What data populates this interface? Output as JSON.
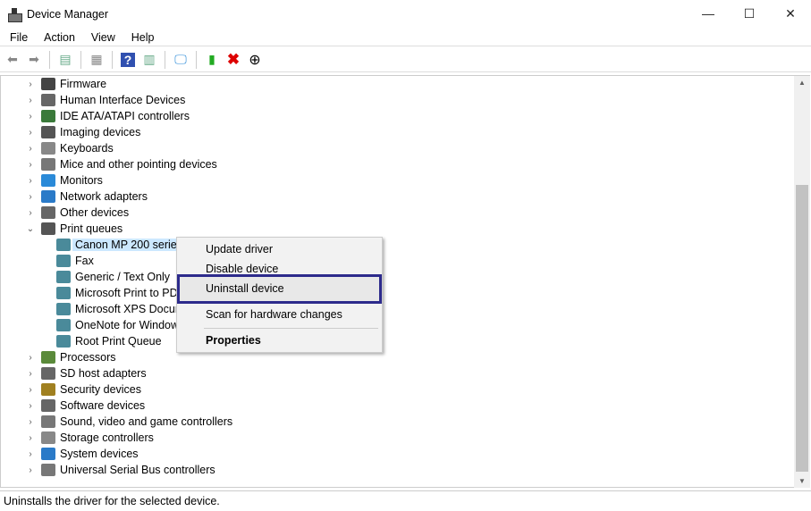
{
  "window": {
    "title": "Device Manager",
    "minimize": "—",
    "maximize": "☐",
    "close": "✕"
  },
  "menu": [
    "File",
    "Action",
    "View",
    "Help"
  ],
  "toolbar": [
    "back-icon",
    "forward-icon",
    "show-hide-console-tree-icon",
    "properties-icon",
    "help-icon",
    "action-pane-icon",
    "scan-hardware-icon",
    "update-driver-icon",
    "uninstall-icon",
    "disable-icon"
  ],
  "tree": [
    {
      "label": "Firmware",
      "level": 0,
      "expanded": false,
      "color": "#444"
    },
    {
      "label": "Human Interface Devices",
      "level": 0,
      "expanded": false,
      "color": "#666"
    },
    {
      "label": "IDE ATA/ATAPI controllers",
      "level": 0,
      "expanded": false,
      "color": "#3a7a3a"
    },
    {
      "label": "Imaging devices",
      "level": 0,
      "expanded": false,
      "color": "#555"
    },
    {
      "label": "Keyboards",
      "level": 0,
      "expanded": false,
      "color": "#888"
    },
    {
      "label": "Mice and other pointing devices",
      "level": 0,
      "expanded": false,
      "color": "#777"
    },
    {
      "label": "Monitors",
      "level": 0,
      "expanded": false,
      "color": "#2a8ad8"
    },
    {
      "label": "Network adapters",
      "level": 0,
      "expanded": false,
      "color": "#2a7ac8"
    },
    {
      "label": "Other devices",
      "level": 0,
      "expanded": false,
      "color": "#666"
    },
    {
      "label": "Print queues",
      "level": 0,
      "expanded": true,
      "color": "#555"
    },
    {
      "label": "Canon MP 200 series",
      "level": 1,
      "selected": true,
      "color": "#4a8a9a"
    },
    {
      "label": "Fax",
      "level": 1,
      "color": "#4a8a9a"
    },
    {
      "label": "Generic / Text Only",
      "level": 1,
      "color": "#4a8a9a"
    },
    {
      "label": "Microsoft Print to PDF",
      "level": 1,
      "color": "#4a8a9a"
    },
    {
      "label": "Microsoft XPS Document Writer",
      "level": 1,
      "color": "#4a8a9a"
    },
    {
      "label": "OneNote for Windows 10",
      "level": 1,
      "color": "#4a8a9a"
    },
    {
      "label": "Root Print Queue",
      "level": 1,
      "color": "#4a8a9a"
    },
    {
      "label": "Processors",
      "level": 0,
      "expanded": false,
      "color": "#5a8a3a"
    },
    {
      "label": "SD host adapters",
      "level": 0,
      "expanded": false,
      "color": "#666"
    },
    {
      "label": "Security devices",
      "level": 0,
      "expanded": false,
      "color": "#a08020"
    },
    {
      "label": "Software devices",
      "level": 0,
      "expanded": false,
      "color": "#666"
    },
    {
      "label": "Sound, video and game controllers",
      "level": 0,
      "expanded": false,
      "color": "#777"
    },
    {
      "label": "Storage controllers",
      "level": 0,
      "expanded": false,
      "color": "#888"
    },
    {
      "label": "System devices",
      "level": 0,
      "expanded": false,
      "color": "#2a7ac8"
    },
    {
      "label": "Universal Serial Bus controllers",
      "level": 0,
      "expanded": false,
      "color": "#777"
    }
  ],
  "context_menu": {
    "items": [
      "Update driver",
      "Disable device",
      "Uninstall device",
      "Scan for hardware changes",
      "Properties"
    ],
    "highlighted": "Uninstall device",
    "highlight_color": "#2d2b8c"
  },
  "status": "Uninstalls the driver for the selected device."
}
